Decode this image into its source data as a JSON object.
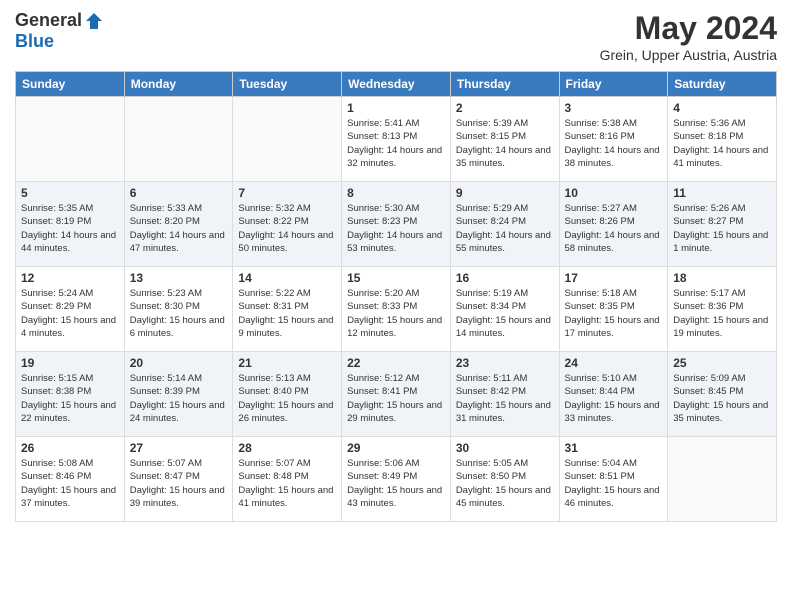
{
  "header": {
    "logo_general": "General",
    "logo_blue": "Blue",
    "title": "May 2024",
    "location": "Grein, Upper Austria, Austria"
  },
  "days_of_week": [
    "Sunday",
    "Monday",
    "Tuesday",
    "Wednesday",
    "Thursday",
    "Friday",
    "Saturday"
  ],
  "weeks": [
    [
      {
        "day": "",
        "sunrise": "",
        "sunset": "",
        "daylight": "",
        "empty": true
      },
      {
        "day": "",
        "sunrise": "",
        "sunset": "",
        "daylight": "",
        "empty": true
      },
      {
        "day": "",
        "sunrise": "",
        "sunset": "",
        "daylight": "",
        "empty": true
      },
      {
        "day": "1",
        "sunrise": "Sunrise: 5:41 AM",
        "sunset": "Sunset: 8:13 PM",
        "daylight": "Daylight: 14 hours and 32 minutes.",
        "empty": false
      },
      {
        "day": "2",
        "sunrise": "Sunrise: 5:39 AM",
        "sunset": "Sunset: 8:15 PM",
        "daylight": "Daylight: 14 hours and 35 minutes.",
        "empty": false
      },
      {
        "day": "3",
        "sunrise": "Sunrise: 5:38 AM",
        "sunset": "Sunset: 8:16 PM",
        "daylight": "Daylight: 14 hours and 38 minutes.",
        "empty": false
      },
      {
        "day": "4",
        "sunrise": "Sunrise: 5:36 AM",
        "sunset": "Sunset: 8:18 PM",
        "daylight": "Daylight: 14 hours and 41 minutes.",
        "empty": false
      }
    ],
    [
      {
        "day": "5",
        "sunrise": "Sunrise: 5:35 AM",
        "sunset": "Sunset: 8:19 PM",
        "daylight": "Daylight: 14 hours and 44 minutes.",
        "empty": false
      },
      {
        "day": "6",
        "sunrise": "Sunrise: 5:33 AM",
        "sunset": "Sunset: 8:20 PM",
        "daylight": "Daylight: 14 hours and 47 minutes.",
        "empty": false
      },
      {
        "day": "7",
        "sunrise": "Sunrise: 5:32 AM",
        "sunset": "Sunset: 8:22 PM",
        "daylight": "Daylight: 14 hours and 50 minutes.",
        "empty": false
      },
      {
        "day": "8",
        "sunrise": "Sunrise: 5:30 AM",
        "sunset": "Sunset: 8:23 PM",
        "daylight": "Daylight: 14 hours and 53 minutes.",
        "empty": false
      },
      {
        "day": "9",
        "sunrise": "Sunrise: 5:29 AM",
        "sunset": "Sunset: 8:24 PM",
        "daylight": "Daylight: 14 hours and 55 minutes.",
        "empty": false
      },
      {
        "day": "10",
        "sunrise": "Sunrise: 5:27 AM",
        "sunset": "Sunset: 8:26 PM",
        "daylight": "Daylight: 14 hours and 58 minutes.",
        "empty": false
      },
      {
        "day": "11",
        "sunrise": "Sunrise: 5:26 AM",
        "sunset": "Sunset: 8:27 PM",
        "daylight": "Daylight: 15 hours and 1 minute.",
        "empty": false
      }
    ],
    [
      {
        "day": "12",
        "sunrise": "Sunrise: 5:24 AM",
        "sunset": "Sunset: 8:29 PM",
        "daylight": "Daylight: 15 hours and 4 minutes.",
        "empty": false
      },
      {
        "day": "13",
        "sunrise": "Sunrise: 5:23 AM",
        "sunset": "Sunset: 8:30 PM",
        "daylight": "Daylight: 15 hours and 6 minutes.",
        "empty": false
      },
      {
        "day": "14",
        "sunrise": "Sunrise: 5:22 AM",
        "sunset": "Sunset: 8:31 PM",
        "daylight": "Daylight: 15 hours and 9 minutes.",
        "empty": false
      },
      {
        "day": "15",
        "sunrise": "Sunrise: 5:20 AM",
        "sunset": "Sunset: 8:33 PM",
        "daylight": "Daylight: 15 hours and 12 minutes.",
        "empty": false
      },
      {
        "day": "16",
        "sunrise": "Sunrise: 5:19 AM",
        "sunset": "Sunset: 8:34 PM",
        "daylight": "Daylight: 15 hours and 14 minutes.",
        "empty": false
      },
      {
        "day": "17",
        "sunrise": "Sunrise: 5:18 AM",
        "sunset": "Sunset: 8:35 PM",
        "daylight": "Daylight: 15 hours and 17 minutes.",
        "empty": false
      },
      {
        "day": "18",
        "sunrise": "Sunrise: 5:17 AM",
        "sunset": "Sunset: 8:36 PM",
        "daylight": "Daylight: 15 hours and 19 minutes.",
        "empty": false
      }
    ],
    [
      {
        "day": "19",
        "sunrise": "Sunrise: 5:15 AM",
        "sunset": "Sunset: 8:38 PM",
        "daylight": "Daylight: 15 hours and 22 minutes.",
        "empty": false
      },
      {
        "day": "20",
        "sunrise": "Sunrise: 5:14 AM",
        "sunset": "Sunset: 8:39 PM",
        "daylight": "Daylight: 15 hours and 24 minutes.",
        "empty": false
      },
      {
        "day": "21",
        "sunrise": "Sunrise: 5:13 AM",
        "sunset": "Sunset: 8:40 PM",
        "daylight": "Daylight: 15 hours and 26 minutes.",
        "empty": false
      },
      {
        "day": "22",
        "sunrise": "Sunrise: 5:12 AM",
        "sunset": "Sunset: 8:41 PM",
        "daylight": "Daylight: 15 hours and 29 minutes.",
        "empty": false
      },
      {
        "day": "23",
        "sunrise": "Sunrise: 5:11 AM",
        "sunset": "Sunset: 8:42 PM",
        "daylight": "Daylight: 15 hours and 31 minutes.",
        "empty": false
      },
      {
        "day": "24",
        "sunrise": "Sunrise: 5:10 AM",
        "sunset": "Sunset: 8:44 PM",
        "daylight": "Daylight: 15 hours and 33 minutes.",
        "empty": false
      },
      {
        "day": "25",
        "sunrise": "Sunrise: 5:09 AM",
        "sunset": "Sunset: 8:45 PM",
        "daylight": "Daylight: 15 hours and 35 minutes.",
        "empty": false
      }
    ],
    [
      {
        "day": "26",
        "sunrise": "Sunrise: 5:08 AM",
        "sunset": "Sunset: 8:46 PM",
        "daylight": "Daylight: 15 hours and 37 minutes.",
        "empty": false
      },
      {
        "day": "27",
        "sunrise": "Sunrise: 5:07 AM",
        "sunset": "Sunset: 8:47 PM",
        "daylight": "Daylight: 15 hours and 39 minutes.",
        "empty": false
      },
      {
        "day": "28",
        "sunrise": "Sunrise: 5:07 AM",
        "sunset": "Sunset: 8:48 PM",
        "daylight": "Daylight: 15 hours and 41 minutes.",
        "empty": false
      },
      {
        "day": "29",
        "sunrise": "Sunrise: 5:06 AM",
        "sunset": "Sunset: 8:49 PM",
        "daylight": "Daylight: 15 hours and 43 minutes.",
        "empty": false
      },
      {
        "day": "30",
        "sunrise": "Sunrise: 5:05 AM",
        "sunset": "Sunset: 8:50 PM",
        "daylight": "Daylight: 15 hours and 45 minutes.",
        "empty": false
      },
      {
        "day": "31",
        "sunrise": "Sunrise: 5:04 AM",
        "sunset": "Sunset: 8:51 PM",
        "daylight": "Daylight: 15 hours and 46 minutes.",
        "empty": false
      },
      {
        "day": "",
        "sunrise": "",
        "sunset": "",
        "daylight": "",
        "empty": true
      }
    ]
  ]
}
